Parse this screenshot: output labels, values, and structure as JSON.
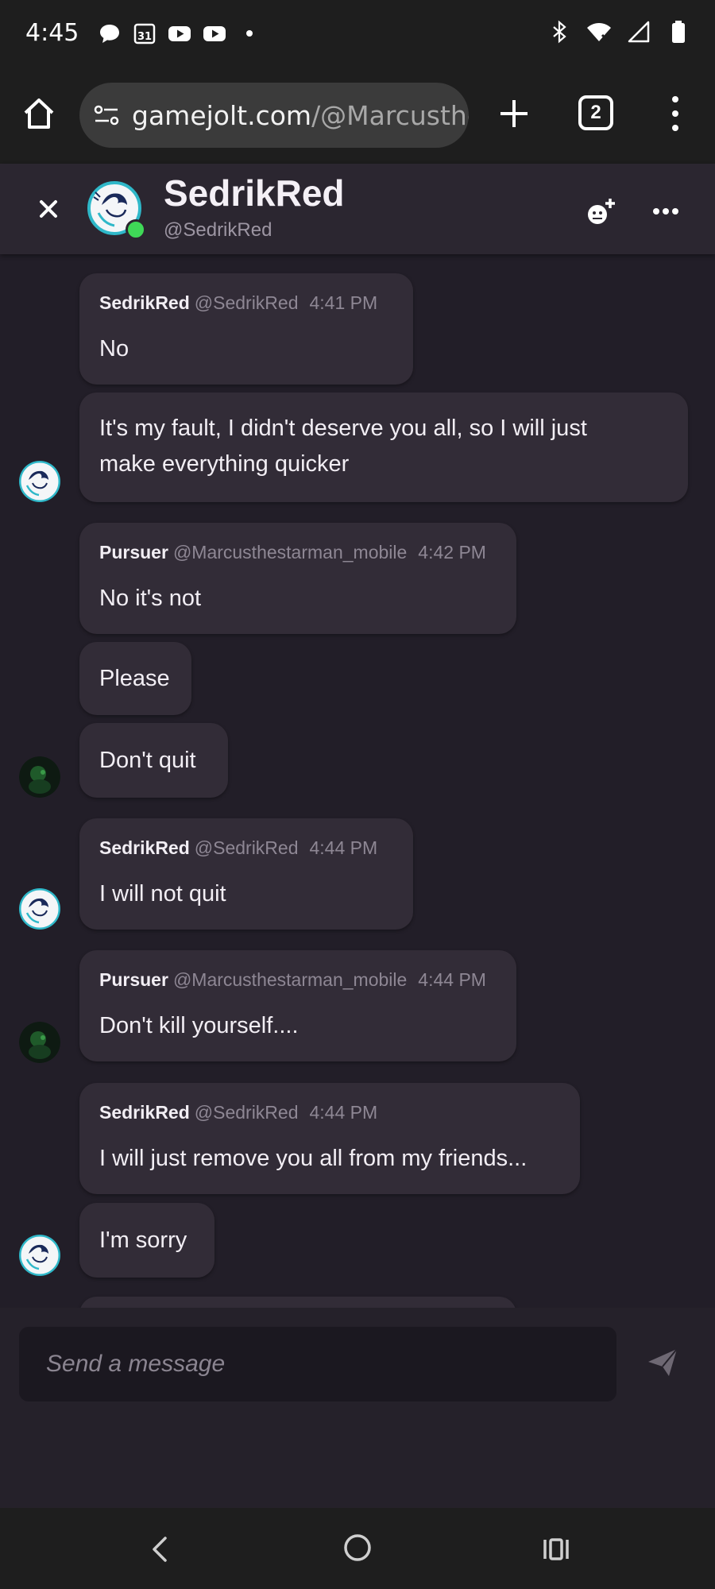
{
  "status_bar": {
    "time": "4:45",
    "left_icons": [
      "chat-bubble-icon",
      "calendar-31-icon",
      "youtube-icon",
      "youtube-icon",
      "dot-icon"
    ],
    "right_icons": [
      "bluetooth-icon",
      "wifi-icon",
      "signal-icon",
      "battery-icon"
    ],
    "calendar_day": "31"
  },
  "browser": {
    "url_host": "gamejolt.com",
    "url_path": "/@Marcusthe",
    "tab_count": "2"
  },
  "chat_header": {
    "name": "SedrikRed",
    "handle": "@SedrikRed",
    "online": true
  },
  "messages": [
    {
      "name": "SedrikRed",
      "handle": "@SedrikRed",
      "time": "4:41 PM",
      "lines": [
        "No"
      ]
    },
    {
      "lines": [
        "It's my fault, I didn't deserve you all, so I will just",
        "make everything quicker"
      ]
    },
    {
      "name": "Pursuer",
      "handle": "@Marcusthestarman_mobile",
      "time": "4:42 PM",
      "lines": [
        "No it's not"
      ]
    },
    {
      "lines": [
        "Please"
      ]
    },
    {
      "lines": [
        "Don't quit"
      ]
    },
    {
      "name": "SedrikRed",
      "handle": "@SedrikRed",
      "time": "4:44 PM",
      "lines": [
        "I will not quit"
      ]
    },
    {
      "name": "Pursuer",
      "handle": "@Marcusthestarman_mobile",
      "time": "4:44 PM",
      "lines": [
        "Don't kill yourself...."
      ]
    },
    {
      "name": "SedrikRed",
      "handle": "@SedrikRed",
      "time": "4:44 PM",
      "lines": [
        "I will just remove you all from my friends..."
      ]
    },
    {
      "lines": [
        "I'm sorry"
      ]
    }
  ],
  "composer": {
    "placeholder": "Send a message"
  },
  "colors": {
    "background": "#221e28",
    "header": "#2b2630",
    "bubble": "#322c37",
    "online": "#3fd857",
    "avatar_accent": "#2fb8c9"
  }
}
